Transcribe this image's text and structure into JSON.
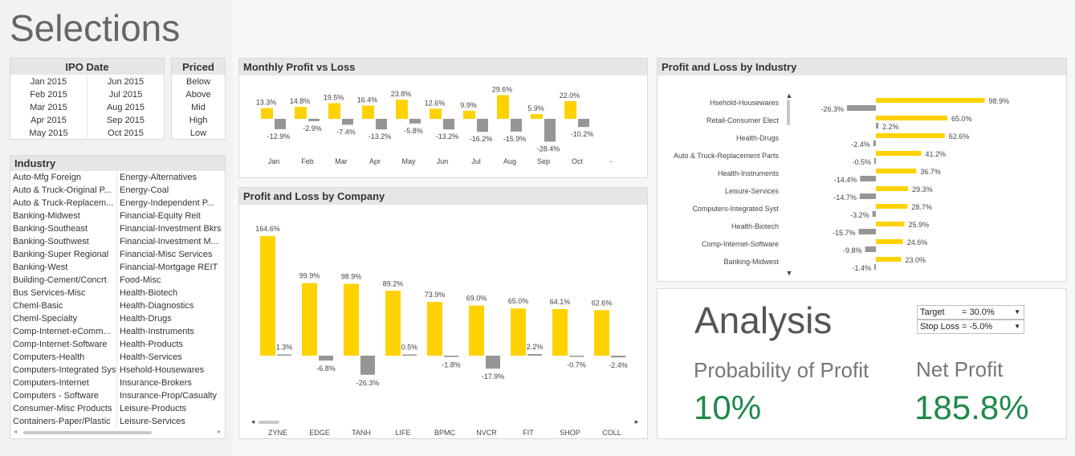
{
  "title": "Selections",
  "ipo_date": {
    "header": "IPO Date",
    "col1": [
      "Jan 2015",
      "Feb 2015",
      "Mar 2015",
      "Apr 2015",
      "May 2015"
    ],
    "col2": [
      "Jun 2015",
      "Jul 2015",
      "Aug 2015",
      "Sep 2015",
      "Oct 2015"
    ]
  },
  "priced": {
    "header": "Priced",
    "items": [
      "Below",
      "Above",
      "Mid",
      "High",
      "Low"
    ]
  },
  "industry": {
    "header": "Industry",
    "col1": [
      "Auto-Mfg Foreign",
      "Auto & Truck-Original P...",
      "Auto & Truck-Replacem...",
      "Banking-Midwest",
      "Banking-Southeast",
      "Banking-Southwest",
      "Banking-Super Regional",
      "Banking-West",
      "Building-Cement/Concrt",
      "Bus Services-Misc",
      "Cheml-Basic",
      "Cheml-Specialty",
      "Comp-Internet-eComm...",
      "Comp-Internet-Software",
      "Computers-Health",
      "Computers-Integrated Syst",
      "Computers-Internet",
      "Computers - Software",
      "Consumer-Misc Products",
      "Containers-Paper/Plastic"
    ],
    "col2": [
      "Energy-Alternatives",
      "Energy-Coal",
      "Energy-Independent P...",
      "Financial-Equity Reit",
      "Financial-Investment Bkrs",
      "Financial-Investment M...",
      "Financial-Misc Services",
      "Financial-Mortgage REIT",
      "Food-Misc",
      "Health-Biotech",
      "Health-Diagnostics",
      "Health-Drugs",
      "Health-Instruments",
      "Health-Products",
      "Health-Services",
      "Hsehold-Housewares",
      "Insurance-Brokers",
      "Insurance-Prop/Casualty",
      "Leisure-Products",
      "Leisure-Services"
    ]
  },
  "monthly": {
    "title": "Monthly Profit vs Loss",
    "colors": {
      "profit": "#ffd200",
      "loss": "#969696"
    }
  },
  "company": {
    "title": "Profit and Loss by Company"
  },
  "industry_chart": {
    "title": "Profit and Loss by Industry"
  },
  "analysis": {
    "title": "Analysis",
    "target_label": "Target",
    "target_value": "= 30.0%",
    "stoploss_label": "Stop Loss",
    "stoploss_value": "= -5.0%",
    "prob_label": "Probability of Profit",
    "prob_value": "10%",
    "net_label": "Net Profit",
    "net_value": "185.8%",
    "value_color": "#1e8a4a"
  },
  "chart_data": [
    {
      "type": "bar",
      "title": "Monthly Profit vs Loss",
      "categories": [
        "Jan",
        "Feb",
        "Mar",
        "Apr",
        "May",
        "Jun",
        "Jul",
        "Aug",
        "Sep",
        "Oct",
        "-"
      ],
      "series": [
        {
          "values": [
            13.3,
            14.8,
            19.5,
            16.4,
            23.8,
            12.6,
            9.9,
            29.6,
            5.9,
            22.0,
            null
          ],
          "labels": [
            "13.3%",
            "14.8%",
            "19.5%",
            "16.4%",
            "23.8%",
            "12.6%",
            "9.9%",
            "29.6%",
            "5.9%",
            "22.0%",
            ""
          ]
        },
        {
          "values": [
            -12.9,
            -2.9,
            -7.4,
            -13.2,
            -5.8,
            -13.2,
            -16.2,
            -15.9,
            -28.4,
            -10.2,
            null
          ],
          "labels": [
            "-12.9%",
            "-2.9%",
            "-7.4%",
            "-13.2%",
            "-5.8%",
            "-13.2%",
            "-16.2%",
            "-15.9%",
            "-28.4%",
            "-10.2%",
            ""
          ]
        }
      ]
    },
    {
      "type": "bar",
      "title": "Profit and Loss by Company",
      "categories": [
        "ZYNE",
        "EDGE",
        "TANH",
        "LIFE",
        "BPMC",
        "NVCR",
        "FIT",
        "SHOP",
        "COLL"
      ],
      "series": [
        {
          "values": [
            164.6,
            99.9,
            98.9,
            89.2,
            73.9,
            69.0,
            65.0,
            64.1,
            62.6
          ],
          "labels": [
            "164.6%",
            "99.9%",
            "98.9%",
            "89.2%",
            "73.9%",
            "69.0%",
            "65.0%",
            "64.1%",
            "62.6%"
          ]
        },
        {
          "values": [
            1.3,
            -6.8,
            -26.3,
            0.5,
            -1.8,
            -17.9,
            2.2,
            -0.7,
            -2.4
          ],
          "labels": [
            "1.3%",
            "-6.8%",
            "-26.3%",
            "0.5%",
            "-1.8%",
            "-17.9%",
            "2.2%",
            "-0.7%",
            "-2.4%"
          ]
        }
      ]
    },
    {
      "type": "bar",
      "title": "Profit and Loss by Industry",
      "categories": [
        "Hsehold-Housewares",
        "Retail-Consumer Elect",
        "Health-Drugs",
        "Auto & Truck-Replacement Parts",
        "Health-Instruments",
        "Leisure-Services",
        "Computers-Integrated Syst",
        "Health-Biotech",
        "Comp-Internet-Software",
        "Banking-Midwest"
      ],
      "series": [
        {
          "values": [
            98.9,
            65.0,
            62.6,
            41.2,
            36.7,
            29.3,
            28.7,
            25.9,
            24.6,
            23.0
          ],
          "labels": [
            "98.9%",
            "65.0%",
            "62.6%",
            "41.2%",
            "36.7%",
            "29.3%",
            "28.7%",
            "25.9%",
            "24.6%",
            "23.0%"
          ]
        },
        {
          "values": [
            -26.3,
            2.2,
            -2.4,
            -0.5,
            -14.4,
            -14.7,
            -3.2,
            -15.7,
            -9.8,
            -1.4
          ],
          "labels": [
            "-26.3%",
            "2.2%",
            "-2.4%",
            "-0.5%",
            "-14.4%",
            "-14.7%",
            "-3.2%",
            "-15.7%",
            "-9.8%",
            "-1.4%"
          ]
        }
      ]
    }
  ]
}
